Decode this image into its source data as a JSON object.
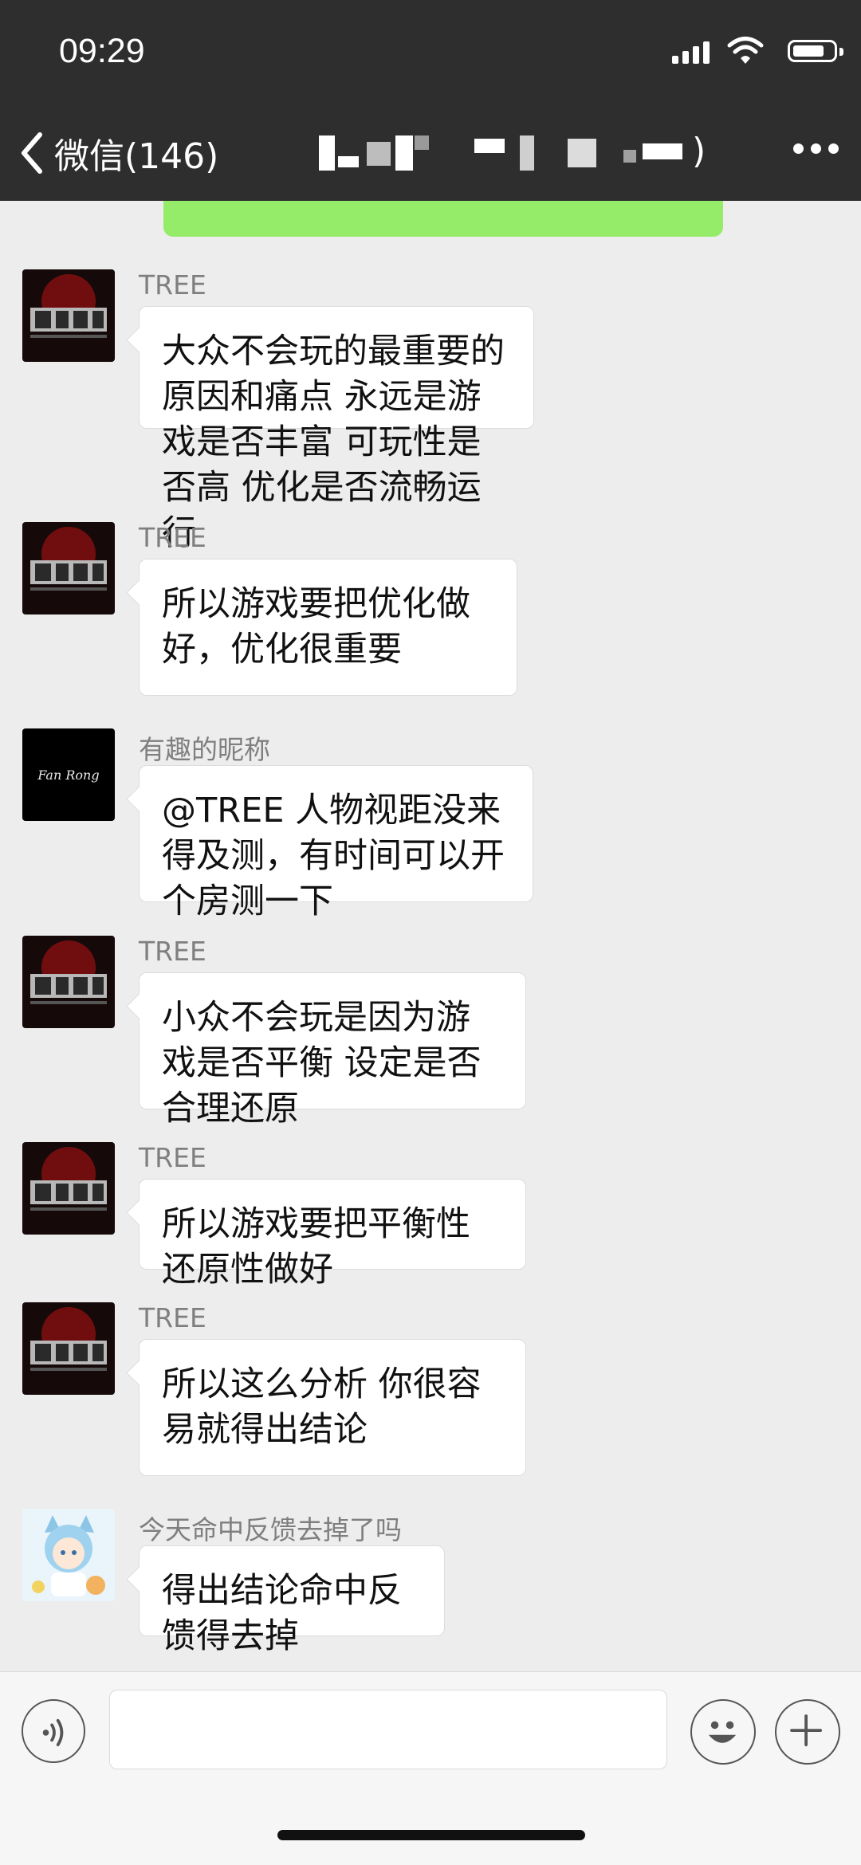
{
  "status_bar": {
    "time": "09:29"
  },
  "nav": {
    "back_label": "微信(146)",
    "title_suffix": ")"
  },
  "messages": [
    {
      "sender": "TREE",
      "avatar": "tree-dragon-avatar",
      "text": "大众不会玩的最重要的原因和痛点 永远是游戏是否丰富 可玩性是否高 优化是否流畅运行"
    },
    {
      "sender": "TREE",
      "avatar": "tree-dragon-avatar",
      "text": "所以游戏要把优化做好，优化很重要"
    },
    {
      "sender": "有趣的昵称",
      "avatar": "fan-rong-avatar",
      "avatar_text": "Fan Rong",
      "text": "@TREE 人物视距没来得及测，有时间可以开个房测一下"
    },
    {
      "sender": "TREE",
      "avatar": "tree-dragon-avatar",
      "text": "小众不会玩是因为游戏是否平衡 设定是否合理还原"
    },
    {
      "sender": "TREE",
      "avatar": "tree-dragon-avatar",
      "text": "所以游戏要把平衡性 还原性做好"
    },
    {
      "sender": "TREE",
      "avatar": "tree-dragon-avatar",
      "text": "所以这么分析 你很容易就得出结论"
    },
    {
      "sender": "今天命中反馈去掉了吗",
      "avatar": "anime-cat-girl-avatar",
      "text": "得出结论命中反馈得去掉"
    }
  ],
  "input_bar": {
    "voice_icon": "voice-icon",
    "emoji_icon": "emoji-icon",
    "plus_icon": "plus-icon"
  },
  "colors": {
    "header_bg": "#2e2e2e",
    "chat_bg": "#ededed",
    "own_bubble": "#95ec69",
    "bubble": "#ffffff"
  }
}
